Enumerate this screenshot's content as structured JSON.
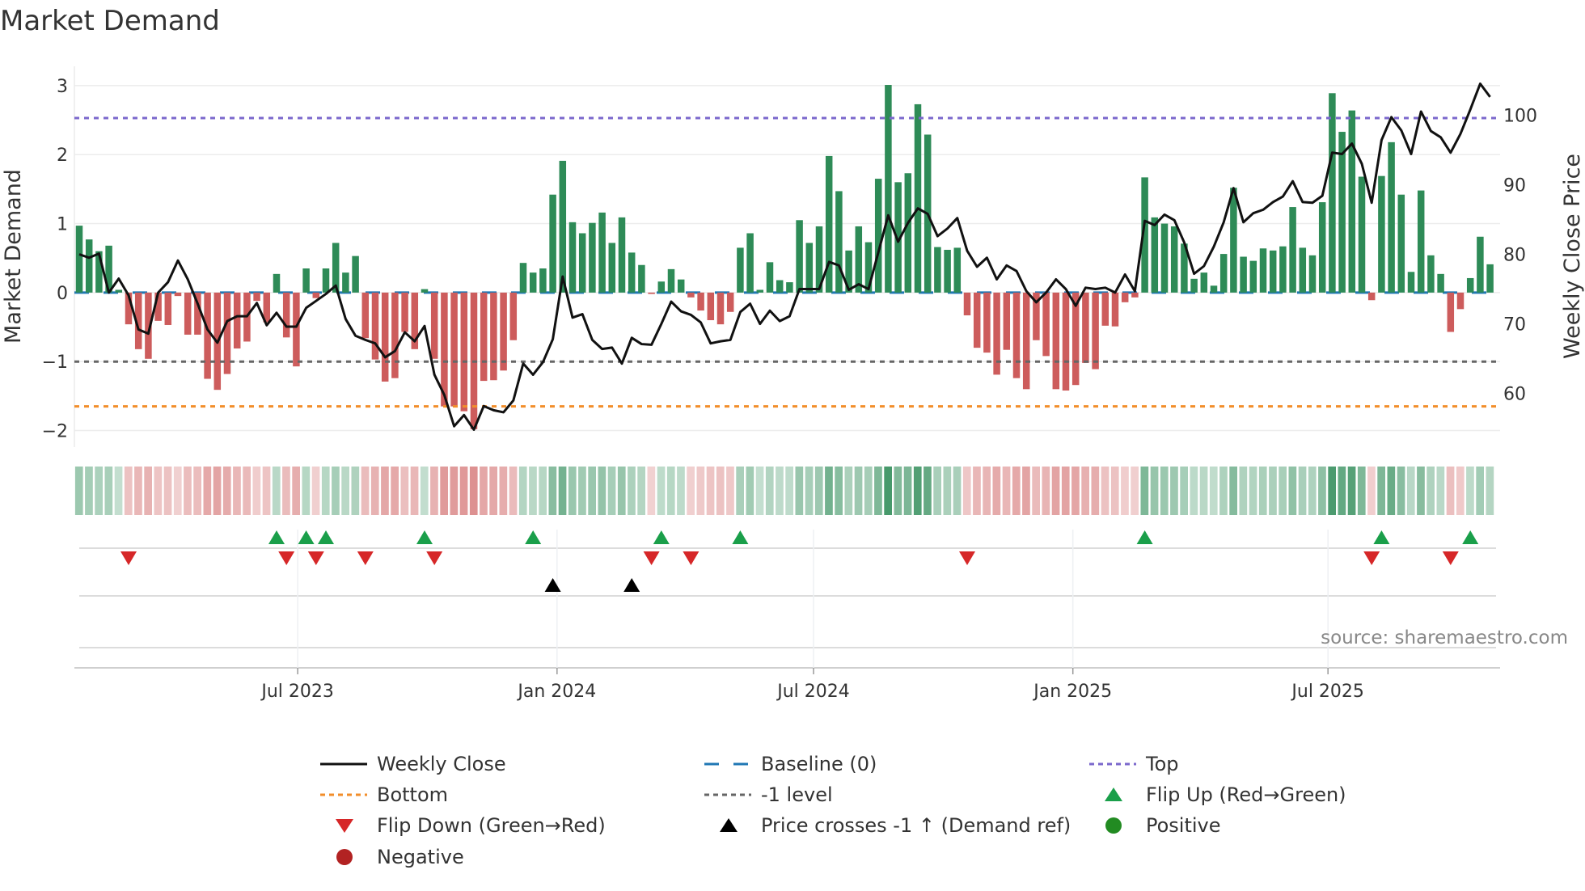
{
  "title": "Market Demand",
  "source": "source: sharemaestro.com",
  "chart_data": {
    "type": "bar+line",
    "title": "Market Demand",
    "ylabel": "Market Demand",
    "y2label": "Weekly Close Price",
    "start_date": "2023-01-27",
    "frequency": "weekly",
    "ylim": [
      -2.24,
      3.28
    ],
    "y2lim": [
      52.3,
      107.0
    ],
    "yticks": [
      {
        "v": -2,
        "label": "−2"
      },
      {
        "v": -1,
        "label": "−1"
      },
      {
        "v": 0,
        "label": "0"
      },
      {
        "v": 1,
        "label": "1"
      },
      {
        "v": 2,
        "label": "2"
      },
      {
        "v": 3,
        "label": "3"
      }
    ],
    "y2ticks": [
      {
        "v": 60,
        "label": "60"
      },
      {
        "v": 70,
        "label": "70"
      },
      {
        "v": 80,
        "label": "80"
      },
      {
        "v": 90,
        "label": "90"
      },
      {
        "v": 100,
        "label": "100"
      }
    ],
    "xticks": [
      {
        "date": "2023-07-01",
        "label": "Jul 2023"
      },
      {
        "date": "2024-01-01",
        "label": "Jan 2024"
      },
      {
        "date": "2024-07-01",
        "label": "Jul 2024"
      },
      {
        "date": "2025-01-01",
        "label": "Jan 2025"
      },
      {
        "date": "2025-07-01",
        "label": "Jul 2025"
      }
    ],
    "levels": {
      "top": 2.53,
      "bottom": -1.65,
      "minus_one": -1,
      "baseline": 0
    },
    "demand": [
      0.97,
      0.77,
      0.6,
      0.68,
      0.04,
      -0.46,
      -0.82,
      -0.96,
      -0.41,
      -0.47,
      -0.05,
      -0.61,
      -0.61,
      -1.25,
      -1.41,
      -1.18,
      -0.81,
      -0.71,
      -0.12,
      -0.43,
      0.27,
      -0.65,
      -1.07,
      0.35,
      -0.08,
      0.35,
      0.72,
      0.29,
      0.53,
      -0.66,
      -0.97,
      -1.29,
      -1.24,
      -0.57,
      -0.82,
      0.05,
      -0.96,
      -1.65,
      -1.65,
      -1.72,
      -1.98,
      -1.28,
      -1.27,
      -1.13,
      -0.69,
      0.43,
      0.29,
      0.35,
      1.42,
      1.91,
      1.02,
      0.86,
      1.01,
      1.16,
      0.72,
      1.09,
      0.58,
      0.4,
      -0.02,
      0.16,
      0.34,
      0.19,
      -0.07,
      -0.26,
      -0.4,
      -0.46,
      -0.28,
      0.65,
      0.86,
      0.04,
      0.44,
      0.18,
      0.15,
      1.05,
      0.72,
      0.96,
      1.98,
      1.47,
      0.61,
      0.96,
      0.73,
      1.65,
      3.01,
      1.6,
      1.73,
      2.73,
      2.29,
      0.66,
      0.62,
      0.65,
      -0.33,
      -0.8,
      -0.87,
      -1.19,
      -0.83,
      -1.24,
      -1.4,
      -0.69,
      -0.92,
      -1.4,
      -1.42,
      -1.34,
      -1.02,
      -1.11,
      -0.48,
      -0.49,
      -0.14,
      -0.07,
      1.67,
      1.09,
      1.0,
      0.96,
      0.71,
      0.2,
      0.29,
      0.1,
      0.56,
      1.52,
      0.52,
      0.46,
      0.64,
      0.61,
      0.67,
      1.24,
      0.65,
      0.54,
      1.31,
      2.89,
      2.33,
      2.64,
      1.68,
      -0.11,
      1.69,
      2.18,
      1.42,
      0.3,
      1.48,
      0.54,
      0.27,
      -0.57,
      -0.24,
      0.21,
      0.81,
      0.41
    ],
    "weekly_close": [
      80.0,
      79.5,
      80.1,
      74.5,
      76.5,
      74.1,
      69.2,
      68.6,
      74.5,
      76.0,
      79.1,
      76.4,
      72.9,
      69.2,
      67.3,
      70.4,
      71.1,
      71.1,
      73.0,
      69.8,
      71.6,
      69.6,
      69.6,
      72.3,
      73.3,
      74.3,
      75.5,
      70.7,
      68.3,
      67.7,
      67.2,
      65.2,
      66.1,
      68.8,
      67.5,
      69.7,
      62.7,
      59.8,
      55.3,
      56.9,
      54.8,
      58.2,
      57.6,
      57.3,
      59.0,
      64.3,
      62.7,
      64.5,
      67.8,
      76.8,
      70.9,
      71.4,
      67.7,
      66.4,
      66.6,
      64.3,
      68.0,
      67.1,
      67.0,
      70.0,
      73.2,
      71.8,
      71.3,
      70.2,
      67.2,
      67.5,
      67.7,
      71.7,
      72.9,
      70.0,
      71.9,
      70.4,
      71.1,
      75.0,
      75.0,
      75.0,
      78.9,
      78.4,
      74.9,
      75.7,
      75.0,
      80.3,
      85.6,
      81.8,
      84.5,
      86.6,
      85.8,
      82.6,
      83.7,
      85.2,
      80.5,
      78.2,
      79.5,
      76.4,
      78.4,
      77.6,
      74.7,
      73.1,
      74.5,
      76.4,
      75.0,
      72.6,
      75.2,
      75.0,
      75.2,
      74.5,
      77.1,
      74.7,
      84.8,
      84.2,
      85.7,
      84.9,
      81.7,
      77.2,
      78.3,
      81.1,
      84.6,
      89.5,
      84.6,
      85.9,
      86.4,
      87.5,
      88.3,
      90.5,
      87.5,
      87.4,
      88.4,
      94.6,
      94.4,
      95.9,
      93.0,
      87.4,
      96.4,
      99.7,
      97.8,
      94.4,
      100.5,
      97.7,
      96.8,
      94.6,
      97.3,
      100.8,
      104.5,
      102.6
    ],
    "flip_up_idx": [
      20,
      23,
      25,
      35,
      46,
      59,
      67,
      108,
      132,
      141
    ],
    "flip_down_idx": [
      5,
      21,
      24,
      29,
      36,
      58,
      62,
      90,
      131,
      139
    ],
    "price_cross_idx": [
      48,
      56
    ],
    "colors": {
      "positive": "#2e8b57",
      "negative": "#cd5c5c",
      "line": "#111111",
      "baseline": "#1f77b4",
      "top": "#7b68cc",
      "bottom": "#f28e2b",
      "minus_one": "#666666",
      "flip_up": "#1a9f4a",
      "flip_down": "#d62728",
      "cross": "#000000",
      "pos_dot": "#228b22",
      "neg_dot": "#b22222"
    },
    "legend": [
      {
        "label": "Weekly Close",
        "sym": "line"
      },
      {
        "label": "Baseline (0)",
        "sym": "baseline"
      },
      {
        "label": "Top",
        "sym": "top"
      },
      {
        "label": "Bottom",
        "sym": "bottom"
      },
      {
        "label": "-1 level",
        "sym": "minus_one"
      },
      {
        "label": "Flip Up (Red→Green)",
        "sym": "flip_up"
      },
      {
        "label": "Flip Down (Green→Red)",
        "sym": "flip_down"
      },
      {
        "label": "Price crosses -1 ↑ (Demand ref)",
        "sym": "cross"
      },
      {
        "label": "Positive",
        "sym": "pos_dot"
      },
      {
        "label": "Negative",
        "sym": "neg_dot"
      }
    ]
  }
}
